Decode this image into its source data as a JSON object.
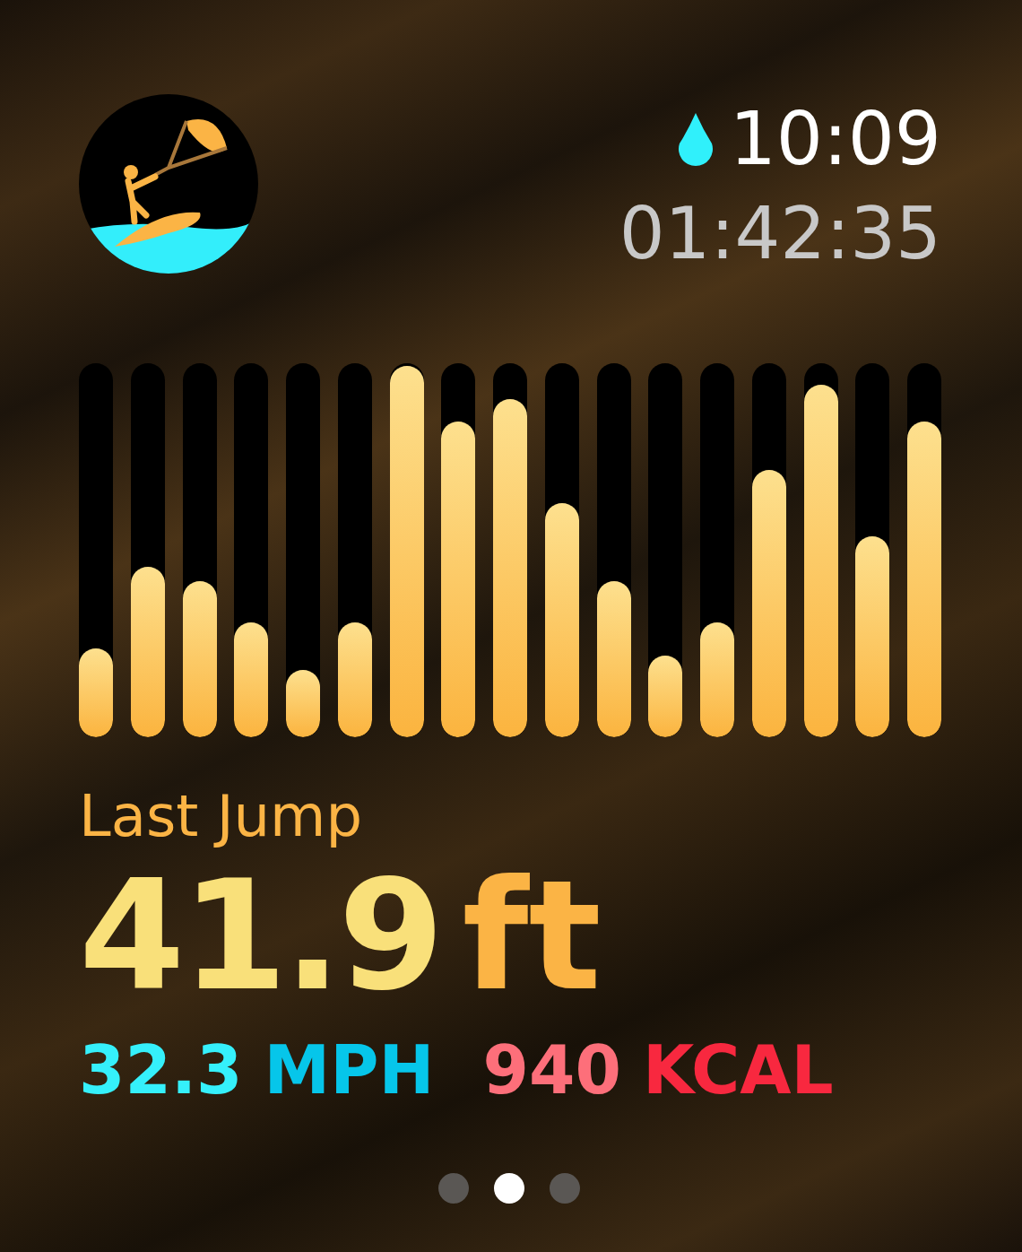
{
  "status": {
    "water_lock": true,
    "time": "10:09",
    "elapsed": "01:42:35"
  },
  "bars": [
    {
      "level": 0.24
    },
    {
      "level": 0.46
    },
    {
      "level": 0.42
    },
    {
      "level": 0.31
    },
    {
      "level": 0.18
    },
    {
      "level": 0.31
    },
    {
      "level": 1.0
    },
    {
      "level": 0.85
    },
    {
      "level": 0.91
    },
    {
      "level": 0.63
    },
    {
      "level": 0.42
    },
    {
      "level": 0.22
    },
    {
      "level": 0.31
    },
    {
      "level": 0.72
    },
    {
      "level": 0.95
    },
    {
      "level": 0.54
    },
    {
      "level": 0.85
    }
  ],
  "metric": {
    "label": "Last Jump",
    "value": "41.9",
    "unit": "ft"
  },
  "stats": [
    {
      "kind": "speed",
      "value": "32.3",
      "unit": "MPH"
    },
    {
      "kind": "calories",
      "value": "940",
      "unit": "KCAL"
    }
  ],
  "pages": [
    {
      "selected": false
    },
    {
      "selected": true
    },
    {
      "selected": false
    }
  ]
}
